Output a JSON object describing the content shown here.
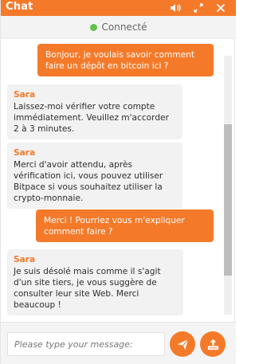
{
  "header": {
    "title": "Chat",
    "icons": [
      "volume-icon",
      "expand-icon",
      "close-icon"
    ]
  },
  "status": {
    "label": "Connecté"
  },
  "messages": [
    {
      "from": "user",
      "text": "Bonjour, je voulais savoir comment faire un dépôt en bitcoin ici ?"
    },
    {
      "from": "agent",
      "name": "Sara",
      "text": "Laissez-moi vérifier votre compte immédiatement. Veuillez m'accorder 2 à 3 minutes."
    },
    {
      "from": "agent",
      "name": "Sara",
      "text": "Merci d'avoir attendu, après vérification ici, vous pouvez utiliser Bitpace si vous souhaitez utiliser la crypto-monnaie."
    },
    {
      "from": "user",
      "text": "Merci ! Pourriez vous m'expliquer comment faire ?"
    },
    {
      "from": "agent",
      "name": "Sara",
      "text": "Je suis désolé mais comme il s'agit d'un site tiers, je vous suggère de consulter leur site Web. Merci beaucoup !"
    }
  ],
  "composer": {
    "placeholder": "Please type your message:",
    "value": ""
  },
  "colors": {
    "accent": "#f47a2a",
    "status_green": "#62c24c"
  }
}
